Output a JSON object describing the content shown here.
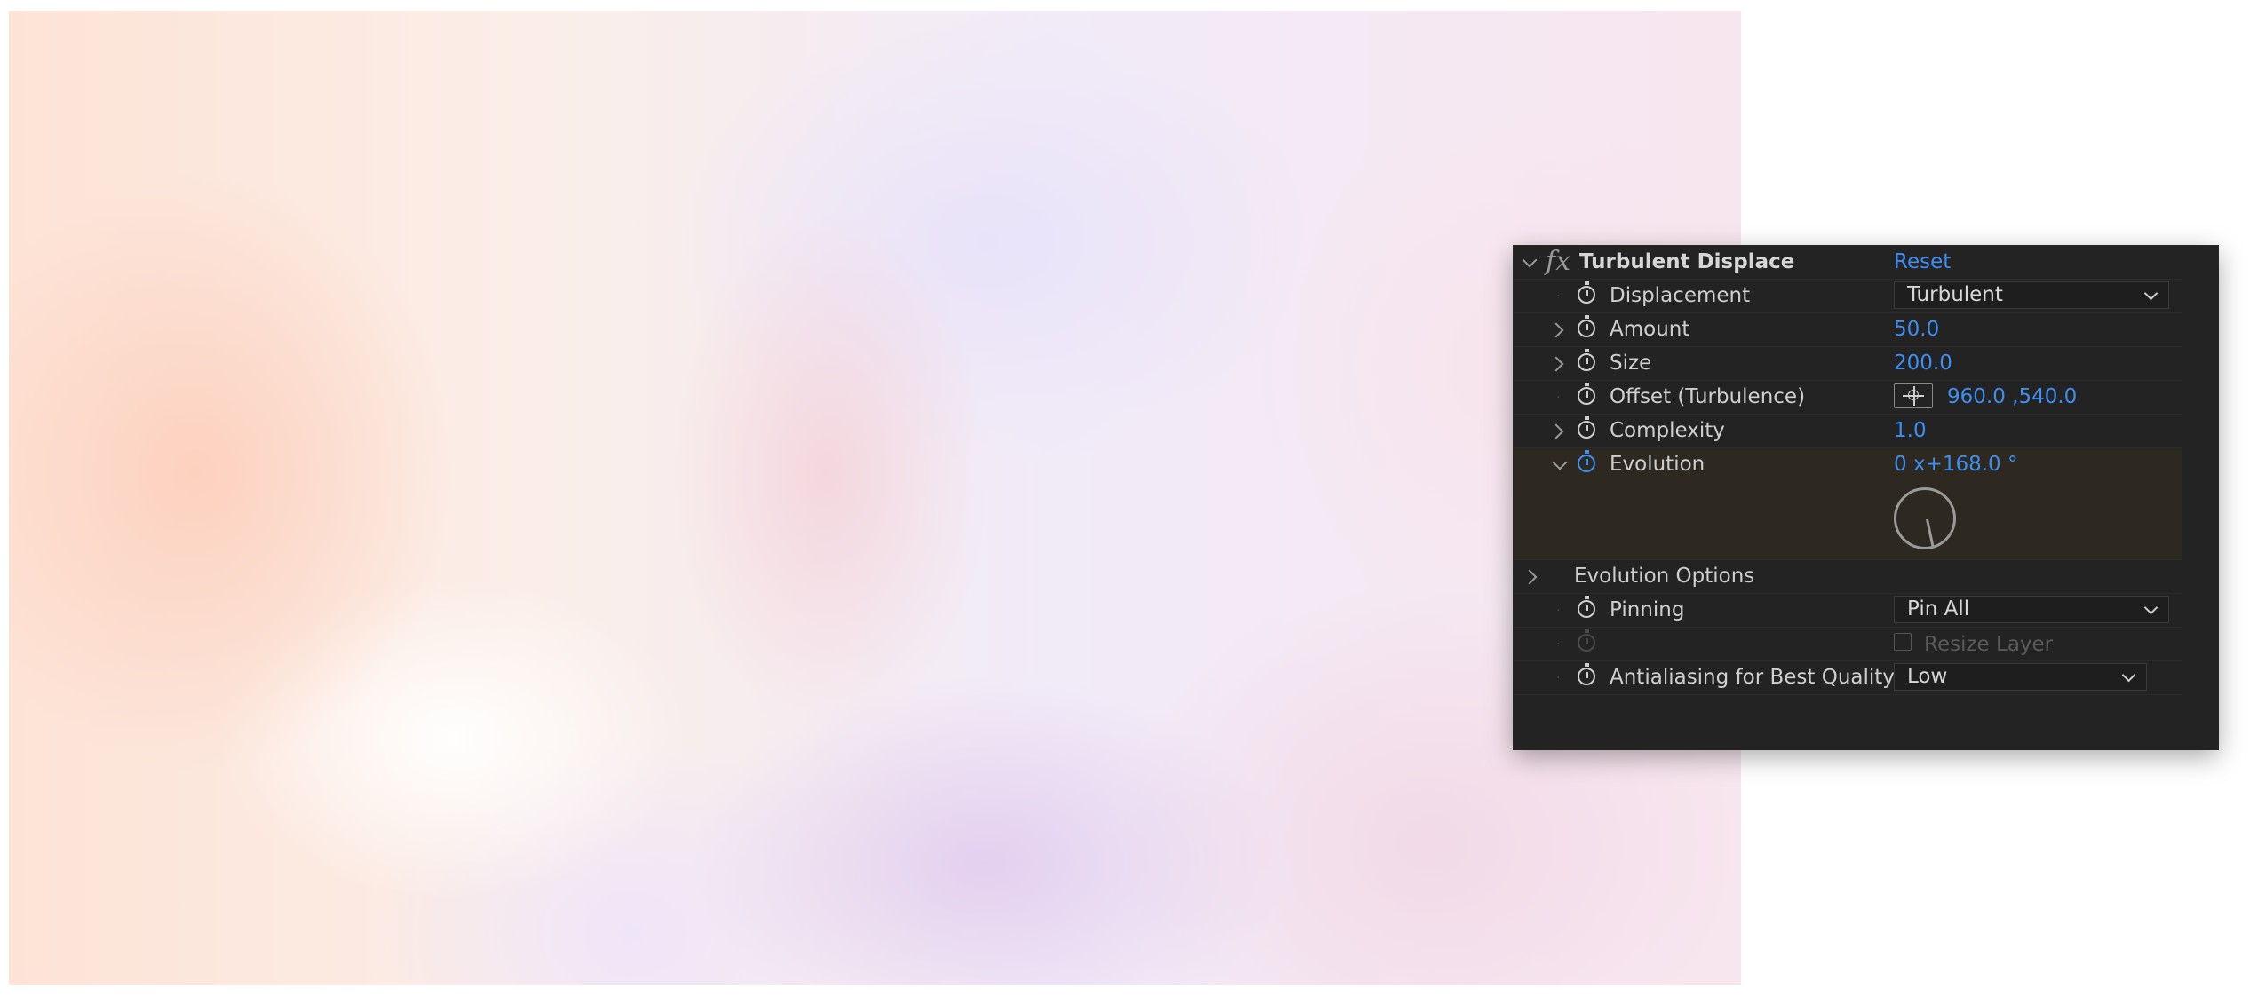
{
  "effect": {
    "title": "Turbulent Displace",
    "reset_label": "Reset",
    "properties": [
      {
        "label": "Displacement",
        "type": "dropdown",
        "value": "Turbulent"
      },
      {
        "label": "Amount",
        "type": "number",
        "value": "50.0"
      },
      {
        "label": "Size",
        "type": "number",
        "value": "200.0"
      },
      {
        "label": "Offset (Turbulence)",
        "type": "point",
        "value": "960.0 ,540.0"
      },
      {
        "label": "Complexity",
        "type": "number",
        "value": "1.0"
      },
      {
        "label": "Evolution",
        "type": "angle",
        "value": "0 x+168.0 °",
        "angle_degrees": 168
      },
      {
        "label": "Evolution Options",
        "type": "group"
      },
      {
        "label": "Pinning",
        "type": "dropdown",
        "value": "Pin All"
      },
      {
        "label": "Resize Layer",
        "type": "checkbox",
        "checked": false
      },
      {
        "label": "Antialiasing for Best Quality",
        "type": "dropdown",
        "value": "Low"
      }
    ]
  },
  "colors": {
    "panel_bg": "#232323",
    "accent_blue": "#3d8ef0",
    "evolution_row_bg": "#2d2820"
  },
  "icons": [
    "chevron-down-icon",
    "fx-icon",
    "stopwatch-icon",
    "chevron-right-icon",
    "crosshair-icon",
    "angle-dial-icon",
    "checkbox-icon"
  ]
}
